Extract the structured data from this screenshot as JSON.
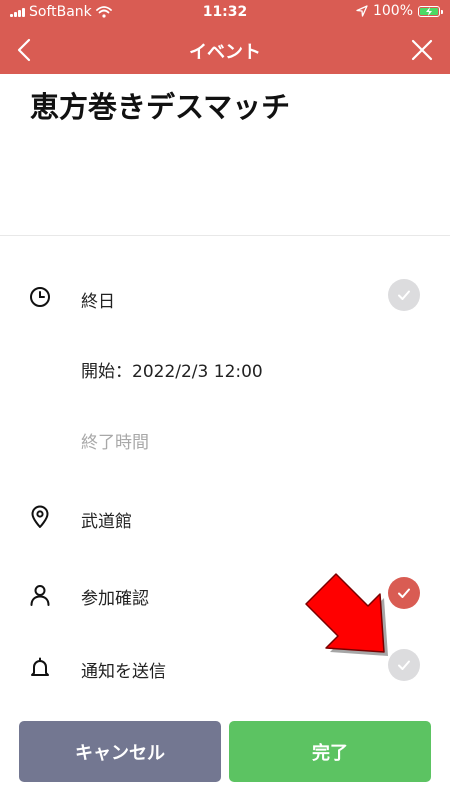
{
  "status_bar": {
    "carrier": "SoftBank",
    "time": "11:32",
    "battery": "100%"
  },
  "nav": {
    "title": "イベント",
    "icons": {
      "back": "chevron-left-icon",
      "close": "close-icon"
    }
  },
  "event": {
    "title": "恵方巻きデスマッチ"
  },
  "rows": {
    "all_day": {
      "label": "終日",
      "icon": "clock-icon",
      "checked": false
    },
    "start": {
      "label": "開始：2022/2/3 12:00"
    },
    "end": {
      "placeholder": "終了時間"
    },
    "location": {
      "label": "武道館",
      "icon": "location-pin-icon"
    },
    "attendance": {
      "label": "参加確認",
      "icon": "person-icon",
      "checked": true
    },
    "notify": {
      "label": "通知を送信",
      "icon": "bell-icon",
      "checked": false
    }
  },
  "buttons": {
    "cancel": "キャンセル",
    "done": "完了"
  },
  "colors": {
    "accent": "#d95c53",
    "cancel": "#737791",
    "done": "#5cc362",
    "check_off": "#dcdcde",
    "annotation_arrow": "#ff0000"
  }
}
